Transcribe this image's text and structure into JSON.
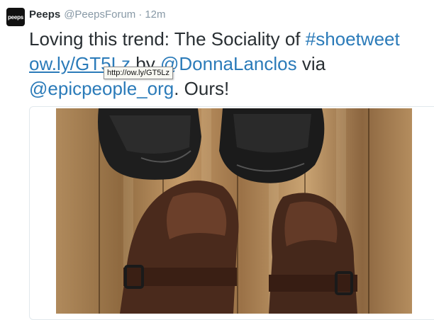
{
  "tweet": {
    "author_name": "Peeps",
    "author_handle": "@PeepsForum",
    "separator": "·",
    "timestamp": "12m",
    "avatar_text": "peeps",
    "text_part1": "Loving this trend: The Sociality of ",
    "hashtag": "#shoetweet",
    "url": "ow.ly/GT5Lz",
    "text_by": " by ",
    "mention1": "@DonnaLanclos",
    "text_via": " via",
    "mention2": "@epicpeople_org",
    "text_end": ". Ours!"
  },
  "tooltip": {
    "text": "http://ow.ly/GT5Lz"
  },
  "colors": {
    "link": "#2b7bb9",
    "text": "#292f33",
    "meta": "#8899a6"
  },
  "media": {
    "description_icon": "shoes-photo"
  }
}
